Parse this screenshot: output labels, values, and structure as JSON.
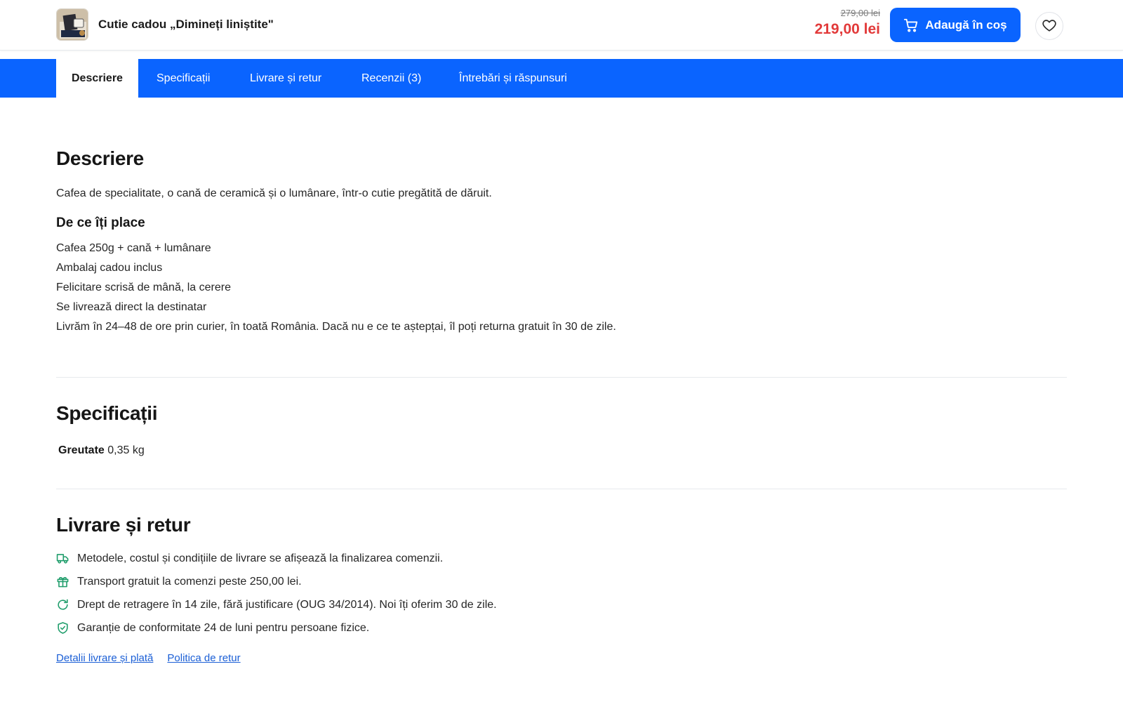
{
  "header": {
    "product_title": "Cutie cadou „Dimineți liniștite\"",
    "price_old": "279,00 lei",
    "price_new": "219,00 lei",
    "cart_button_label": "Adaugă în coș"
  },
  "tabs": [
    {
      "label": "Descriere",
      "active": true
    },
    {
      "label": "Specificații",
      "active": false
    },
    {
      "label": "Livrare și retur",
      "active": false
    },
    {
      "label": "Recenzii (3)",
      "active": false
    },
    {
      "label": "Întrebări și răspunsuri",
      "active": false
    }
  ],
  "description": {
    "title": "Descriere",
    "lead": "Cafea de specialitate, o cană de ceramică și o lumânare, într-o cutie pregătită de dăruit.",
    "why_title": "De ce îți place",
    "features": [
      "Cafea 250g + cană + lumânare",
      "Ambalaj cadou inclus",
      "Felicitare scrisă de mână, la cerere",
      "Se livrează direct la destinatar",
      "Livrăm în 24–48 de ore prin curier, în toată România. Dacă nu e ce te aștepțai, îl poți returna gratuit în 30 de zile."
    ]
  },
  "specifications": {
    "title": "Specificații",
    "rows": [
      {
        "label": "Greutate",
        "value": "0,35 kg"
      }
    ]
  },
  "delivery": {
    "title": "Livrare și retur",
    "items": [
      {
        "icon": "truck-icon",
        "text": "Metodele, costul și condițiile de livrare se afișează la finalizarea comenzii."
      },
      {
        "icon": "gift-icon",
        "text": "Transport gratuit la comenzi peste 250,00 lei."
      },
      {
        "icon": "refresh-icon",
        "text": "Drept de retragere în 14 zile, fără justificare (OUG 34/2014). Noi îți oferim 30 de zile."
      },
      {
        "icon": "shield-check-icon",
        "text": "Garanție de conformitate 24 de luni pentru persoane fizice."
      }
    ],
    "links": [
      "Detalii livrare și plată",
      "Politica de retur"
    ]
  },
  "colors": {
    "accent": "#0a64ff",
    "price_red": "#e23a3a",
    "icon_green": "#1f9d6b",
    "link_blue": "#1b5fd6"
  }
}
